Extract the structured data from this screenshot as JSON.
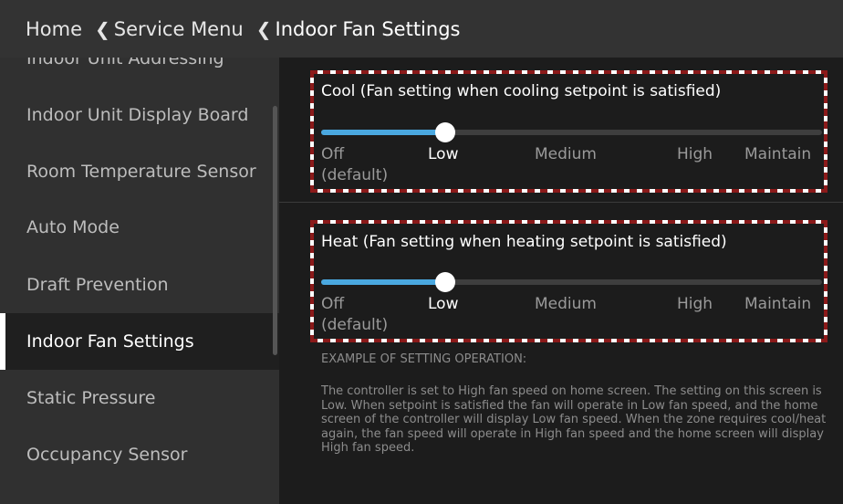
{
  "breadcrumb": {
    "home": "Home",
    "service_menu": "Service Menu",
    "current": "Indoor Fan Settings"
  },
  "sidebar": {
    "items": [
      {
        "label": "Indoor Unit Addressing"
      },
      {
        "label": "Indoor Unit Display Board"
      },
      {
        "label": "Room Temperature Sensor"
      },
      {
        "label": "Auto Mode"
      },
      {
        "label": "Draft Prevention"
      },
      {
        "label": "Indoor Fan Settings",
        "active": true
      },
      {
        "label": "Static Pressure"
      },
      {
        "label": "Occupancy Sensor"
      }
    ]
  },
  "cool": {
    "title": "Cool (Fan setting when cooling setpoint is satisfied)",
    "options": [
      "Off",
      "Low",
      "Medium",
      "High",
      "Maintain"
    ],
    "off_default_note": "(default)",
    "selected": "Low"
  },
  "heat": {
    "title": "Heat (Fan setting when heating setpoint is satisfied)",
    "options": [
      "Off",
      "Low",
      "Medium",
      "High",
      "Maintain"
    ],
    "off_default_note": "(default)",
    "selected": "Low"
  },
  "example": {
    "heading": "EXAMPLE OF SETTING OPERATION:",
    "body": "The controller is set to High fan speed on home screen. The setting on this screen is Low.  When setpoint is satisfied the fan will operate in Low fan speed, and the home screen of the controller will display Low fan speed. When the zone requires cool/heat again, the fan speed will operate in High fan speed and the home screen will display High fan speed."
  },
  "colors": {
    "accent": "#4aa8e0",
    "header_bg": "#333333",
    "sidebar_bg": "#303030",
    "content_bg": "#1c1c1c",
    "highlight_dash": "#8b1a1a"
  }
}
